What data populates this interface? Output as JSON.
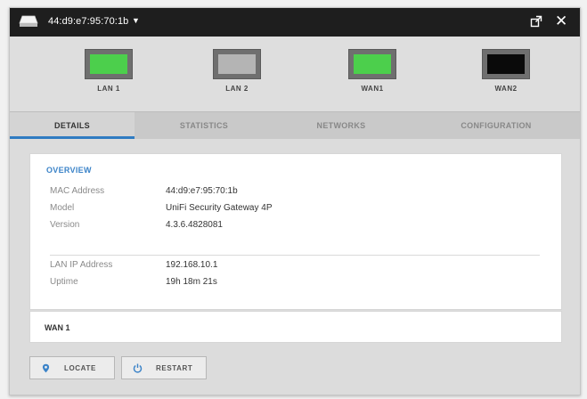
{
  "titlebar": {
    "device_name": "44:d9:e7:95:70:1b",
    "dropdown_caret": "▼",
    "close_glyph": "✕"
  },
  "ports": [
    {
      "label": "LAN 1",
      "status_color": "#4ccf4c"
    },
    {
      "label": "LAN 2",
      "status_color": "#b4b4b4"
    },
    {
      "label": "WAN1",
      "status_color": "#4ccf4c"
    },
    {
      "label": "WAN2",
      "status_color": "#0a0a0a"
    }
  ],
  "tabs": [
    {
      "label": "DETAILS",
      "active": true
    },
    {
      "label": "STATISTICS",
      "active": false
    },
    {
      "label": "NETWORKS",
      "active": false
    },
    {
      "label": "CONFIGURATION",
      "active": false
    }
  ],
  "overview": {
    "title": "OVERVIEW",
    "rows": [
      {
        "label": "MAC Address",
        "value": "44:d9:e7:95:70:1b"
      },
      {
        "label": "Model",
        "value": "UniFi Security Gateway 4P"
      },
      {
        "label": "Version",
        "value": "4.3.6.4828081"
      },
      {
        "label": "LAN IP Address",
        "value": "192.168.10.1"
      },
      {
        "label": "Uptime",
        "value": "19h 18m 21s"
      }
    ]
  },
  "wan_section": {
    "title": "WAN 1"
  },
  "buttons": {
    "locate": "LOCATE",
    "restart": "RESTART"
  },
  "colors": {
    "accent": "#2f7bc2",
    "titlebar_bg": "#1e1e1e"
  }
}
